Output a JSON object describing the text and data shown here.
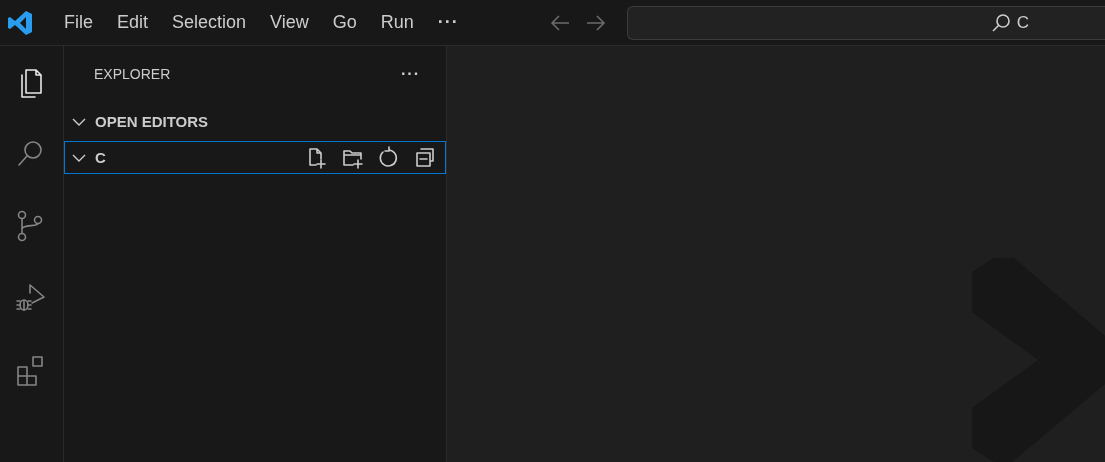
{
  "title_bar": {
    "menu": [
      {
        "label": "File"
      },
      {
        "label": "Edit"
      },
      {
        "label": "Selection"
      },
      {
        "label": "View"
      },
      {
        "label": "Go"
      },
      {
        "label": "Run"
      },
      {
        "label": "···",
        "kind": "more"
      }
    ],
    "search": {
      "value": "C"
    }
  },
  "activity_bar": [
    {
      "kind": "explorer",
      "selected": true
    },
    {
      "kind": "search",
      "selected": false
    },
    {
      "kind": "source-control",
      "selected": false
    },
    {
      "kind": "run-debug",
      "selected": false
    },
    {
      "kind": "extensions",
      "selected": false
    }
  ],
  "sidebar": {
    "title": "EXPLORER",
    "more": "···",
    "sections": [
      {
        "label": "OPEN EDITORS",
        "expanded": true,
        "focused": false
      },
      {
        "label": "C",
        "expanded": true,
        "focused": true,
        "actions": [
          {
            "kind": "new-file"
          },
          {
            "kind": "new-folder"
          },
          {
            "kind": "refresh"
          },
          {
            "kind": "collapse"
          }
        ]
      }
    ]
  }
}
